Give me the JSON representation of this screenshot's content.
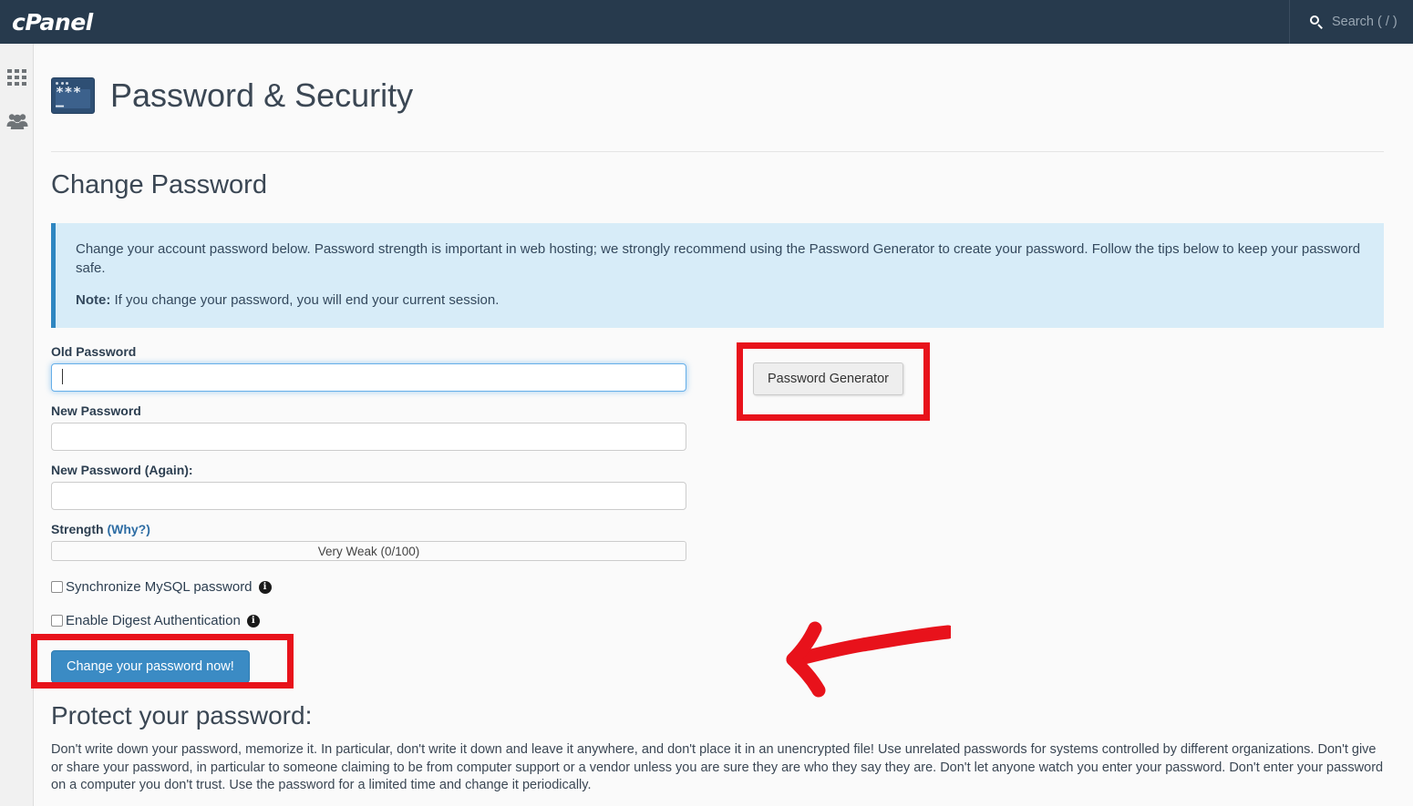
{
  "header": {
    "brand": "cPanel",
    "search_placeholder": "Search ( / )",
    "search_icon": "search-icon"
  },
  "sidebar": {
    "items": [
      {
        "icon": "grid-icon",
        "label": "Home"
      },
      {
        "icon": "users-icon",
        "label": "User Manager"
      }
    ]
  },
  "page": {
    "icon": "password-security-icon",
    "icon_glyph": "***—",
    "title": "Password & Security",
    "section_title": "Change Password",
    "protect_title": "Protect your password:",
    "protect_text": "Don't write down your password, memorize it. In particular, don't write it down and leave it anywhere, and don't place it in an unencrypted file! Use unrelated passwords for systems controlled by different organizations. Don't give or share your password, in particular to someone claiming to be from computer support or a vendor unless you are sure they are who they say they are. Don't let anyone watch you enter your password. Don't enter your password on a computer you don't trust. Use the password for a limited time and change it periodically."
  },
  "banner": {
    "paragraph": "Change your account password below. Password strength is important in web hosting; we strongly recommend using the Password Generator to create your password. Follow the tips below to keep your password safe.",
    "note_label": "Note:",
    "note_text": "If you change your password, you will end your current session."
  },
  "form": {
    "old_password": {
      "label": "Old Password",
      "value": "",
      "focused": true
    },
    "new_password": {
      "label": "New Password",
      "value": ""
    },
    "new_password_again": {
      "label": "New Password (Again):",
      "value": ""
    },
    "strength": {
      "label_text": "Strength ",
      "label_link": "(Why?)",
      "bar_text": "Very Weak (0/100)",
      "score": 0,
      "max": 100
    },
    "generator_button": "Password Generator",
    "checkboxes": [
      {
        "label": "Synchronize MySQL password",
        "checked": false,
        "info": "i"
      },
      {
        "label": "Enable Digest Authentication",
        "checked": false,
        "info": "i"
      }
    ],
    "submit_button": "Change your password now!"
  },
  "annotations": {
    "arrow_color": "#e8121b",
    "box_color": "#e8121b",
    "arrow_target": "old-password-input",
    "boxed_items": [
      "password-generator-button",
      "change-password-submit-button"
    ]
  },
  "colors": {
    "topbar": "#273a4d",
    "banner_bg": "#d7ecf8",
    "banner_border": "#2e86c1",
    "primary_button": "#3b8bc4",
    "page_bg": "#fafafa",
    "annotation_red": "#e8121b"
  }
}
